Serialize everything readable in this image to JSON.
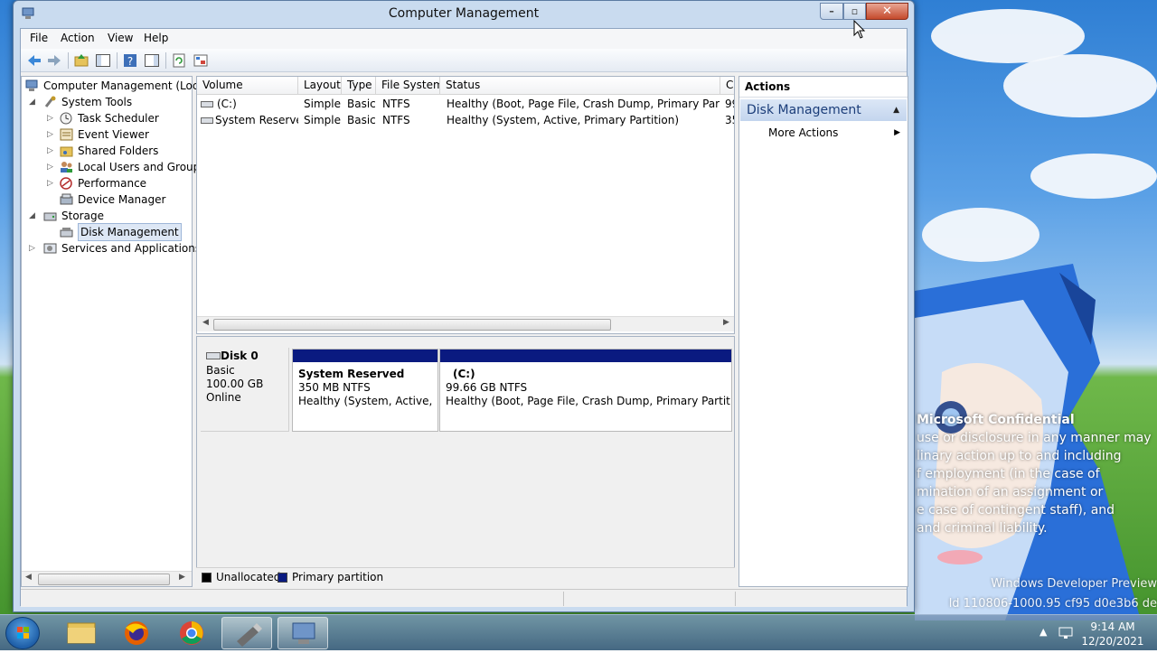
{
  "window": {
    "title": "Computer Management",
    "close_glyph": "✕",
    "min_glyph": "–",
    "max_glyph": "▫"
  },
  "menu": [
    "File",
    "Action",
    "View",
    "Help"
  ],
  "tree": {
    "root": "Computer Management (Local",
    "system_tools": "System Tools",
    "task_scheduler": "Task Scheduler",
    "event_viewer": "Event Viewer",
    "shared_folders": "Shared Folders",
    "local_users": "Local Users and Groups",
    "performance": "Performance",
    "device_manager": "Device Manager",
    "storage": "Storage",
    "disk_management": "Disk Management",
    "services": "Services and Applications"
  },
  "volumes": {
    "headers": [
      "Volume",
      "Layout",
      "Type",
      "File System",
      "Status",
      "C"
    ],
    "rows": [
      {
        "volume": "(C:)",
        "layout": "Simple",
        "type": "Basic",
        "fs": "NTFS",
        "status": "Healthy (Boot, Page File, Crash Dump, Primary Partition)",
        "cap": "99"
      },
      {
        "volume": "System Reserved",
        "layout": "Simple",
        "type": "Basic",
        "fs": "NTFS",
        "status": "Healthy (System, Active, Primary Partition)",
        "cap": "35"
      }
    ]
  },
  "disk": {
    "name": "Disk 0",
    "type": "Basic",
    "size": "100.00 GB",
    "state": "Online",
    "partitions": [
      {
        "name": "System Reserved",
        "size": "350 MB NTFS",
        "status": "Healthy (System, Active, Pri"
      },
      {
        "name": "(C:)",
        "size": "99.66 GB NTFS",
        "status": "Healthy (Boot, Page File, Crash Dump, Primary Partition)"
      }
    ]
  },
  "legend": {
    "unallocated": "Unallocated",
    "primary": "Primary partition",
    "unallocated_color": "#000000",
    "primary_color": "#0a1a80"
  },
  "actions": {
    "header": "Actions",
    "group": "Disk Management",
    "more": "More Actions"
  },
  "desktop": {
    "watermark_title": "Microsoft Confidential",
    "watermark_lines": [
      "use or disclosure in any manner may",
      "linary action up to and including",
      "f employment (in the case of",
      "mination of an assignment or",
      "e case of contingent staff), and",
      "and criminal liability."
    ],
    "build_lines": [
      "Windows Developer Preview",
      "ld 110806-1000.95 cf95 d0e3b6 de"
    ]
  },
  "taskbar": {
    "time": "9:14 AM",
    "date": "12/20/2021"
  },
  "colors": {
    "accent": "#0a1a80",
    "selection": "#dde7f5"
  }
}
